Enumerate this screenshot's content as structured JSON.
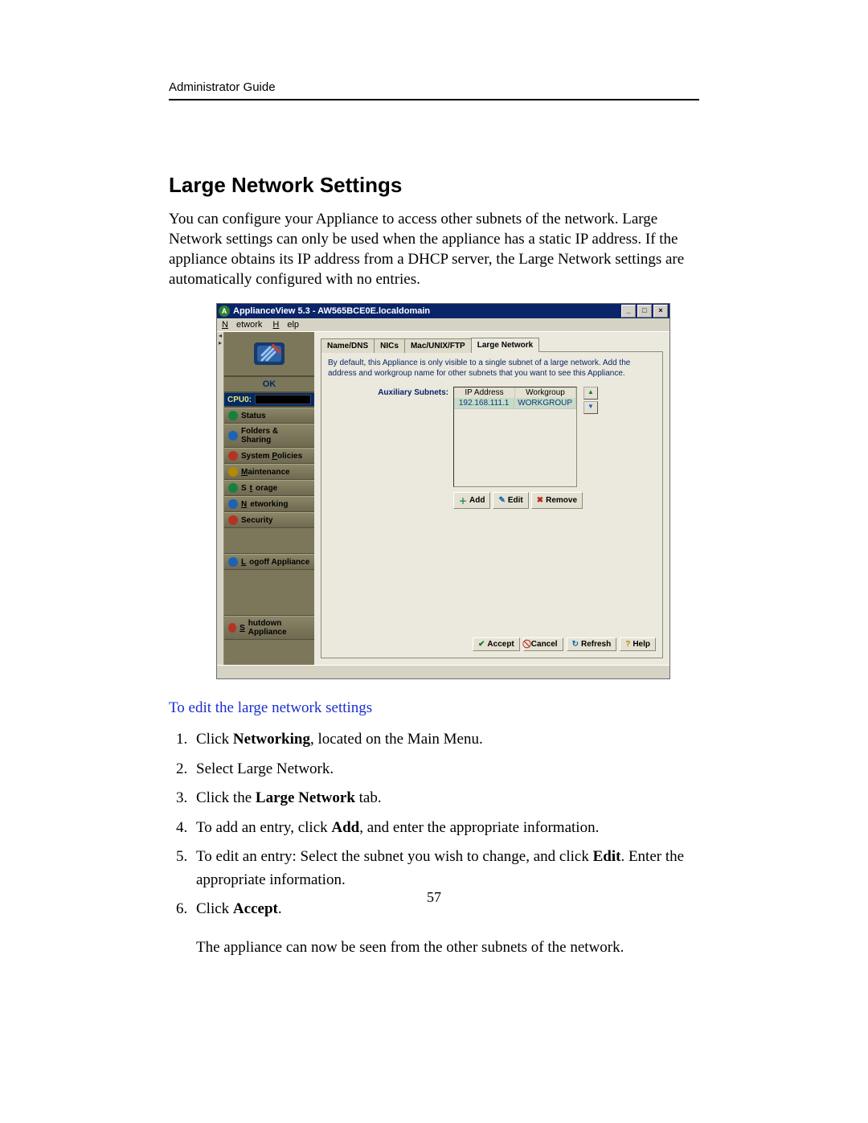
{
  "doc": {
    "running_head": "Administrator Guide",
    "section_title": "Large Network Settings",
    "intro": "You can configure your Appliance to access other subnets of the network.  Large Network settings can only be used when the appliance has a static IP address.  If the appliance obtains its IP address from a DHCP server, the Large Network settings are automatically configured with no entries.",
    "subhead": "To edit the large network settings",
    "steps": [
      "Click Networking, located on the Main Menu.",
      "Select Large Network.",
      "Click the Large Network tab.",
      "To add an entry, click Add, and enter the appropriate information.",
      "To edit an entry: Select the subnet you wish to change, and click Edit. Enter the appropriate information.",
      "Click Accept."
    ],
    "trail": "The appliance can now be seen from the other subnets of the network.",
    "page_number": "57"
  },
  "win": {
    "title": "ApplianceView 5.3 - AW565BCE0E.localdomain",
    "menus": {
      "network": "Network",
      "help": "Help"
    },
    "ok_label": "OK",
    "cpu_label": "CPU0:",
    "nav": {
      "status": "Status",
      "folders": "Folders & Sharing",
      "policies": "System Policies",
      "maintenance": "Maintenance",
      "storage": "Storage",
      "networking": "Networking",
      "security": "Security",
      "logoff": "Logoff Appliance",
      "shutdown": "Shutdown Appliance"
    },
    "tabs": {
      "namedns": "Name/DNS",
      "nics": "NICs",
      "mac": "Mac/UNIX/FTP",
      "large": "Large Network"
    },
    "desc": "By default, this Appliance is only visible to a single subnet of a large network. Add the address and workgroup name for other subnets that you want to see this Appliance.",
    "aux_label": "Auxiliary Subnets:",
    "grid": {
      "col_ip": "IP Address",
      "col_wg": "Workgroup",
      "row_ip": "192.168.111.1",
      "row_wg": "WORKGROUP"
    },
    "btn": {
      "add": "Add",
      "edit": "Edit",
      "remove": "Remove",
      "accept": "Accept",
      "cancel": "Cancel",
      "refresh": "Refresh",
      "help": "Help"
    }
  }
}
